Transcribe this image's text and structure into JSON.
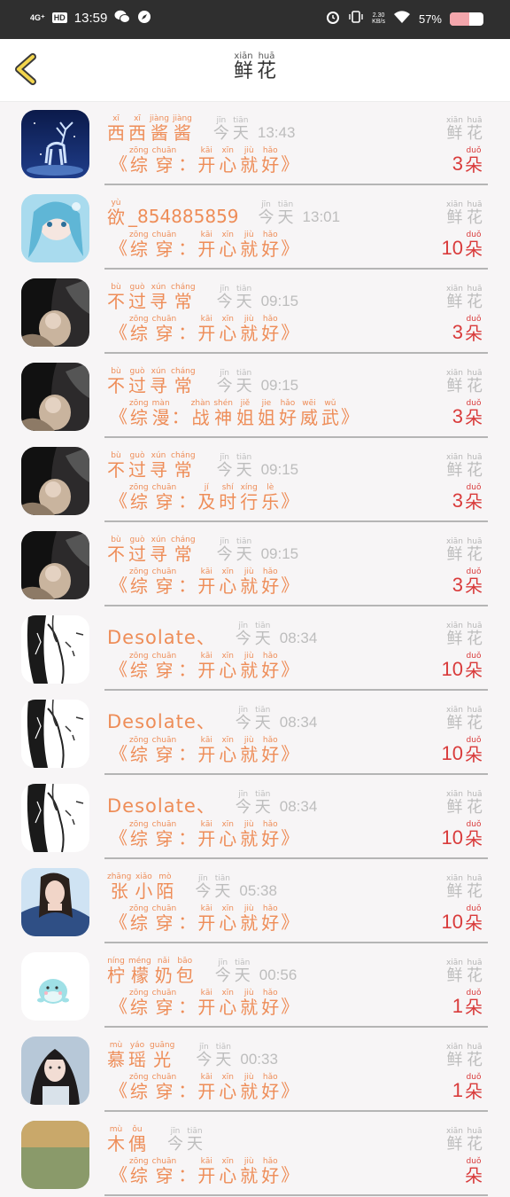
{
  "statusbar": {
    "network": "4G⁺",
    "hd": "HD",
    "time": "13:59",
    "speed_value": "2.30",
    "speed_unit": "KB/s",
    "battery_pct": "57%",
    "battery_level": 0.57
  },
  "header": {
    "title": [
      {
        "py": "xiān",
        "hz": "鲜"
      },
      {
        "py": "huā",
        "hz": "花"
      }
    ]
  },
  "common": {
    "flower_label": [
      {
        "py": "xiān",
        "hz": "鲜"
      },
      {
        "py": "huā",
        "hz": "花"
      }
    ],
    "duo": {
      "py": "duǒ",
      "hz": "朵"
    },
    "today": [
      {
        "py": "jīn",
        "hz": "今"
      },
      {
        "py": "tiān",
        "hz": "天"
      }
    ],
    "open_quote": "《",
    "close_quote": "》"
  },
  "rows": [
    {
      "avatar": "deer",
      "name": [
        {
          "py": "xī",
          "hz": "西"
        },
        {
          "py": "xī",
          "hz": "西"
        },
        {
          "py": "jiàng",
          "hz": "酱"
        },
        {
          "py": "jiàng",
          "hz": "酱"
        }
      ],
      "time": "13:43",
      "msg_type": [
        {
          "py": "zōng",
          "hz": "综"
        },
        {
          "py": "chuān",
          "hz": "穿"
        }
      ],
      "colon": "：",
      "msg_title": [
        {
          "py": "kāi",
          "hz": "开"
        },
        {
          "py": "xīn",
          "hz": "心"
        },
        {
          "py": "jiù",
          "hz": "就"
        },
        {
          "py": "hǎo",
          "hz": "好"
        }
      ],
      "count": "3"
    },
    {
      "avatar": "anime-blue",
      "name": [
        {
          "py": "yù",
          "hz": "欲"
        }
      ],
      "name_suffix": "_854885859",
      "time": "13:01",
      "msg_type": [
        {
          "py": "zōng",
          "hz": "综"
        },
        {
          "py": "chuān",
          "hz": "穿"
        }
      ],
      "colon": "：",
      "msg_title": [
        {
          "py": "kāi",
          "hz": "开"
        },
        {
          "py": "xīn",
          "hz": "心"
        },
        {
          "py": "jiù",
          "hz": "就"
        },
        {
          "py": "hǎo",
          "hz": "好"
        }
      ],
      "count": "10"
    },
    {
      "avatar": "dark-photo",
      "name": [
        {
          "py": "bù",
          "hz": "不"
        },
        {
          "py": "guò",
          "hz": "过"
        },
        {
          "py": "xún",
          "hz": "寻"
        },
        {
          "py": "cháng",
          "hz": "常"
        }
      ],
      "time": "09:15",
      "msg_type": [
        {
          "py": "zōng",
          "hz": "综"
        },
        {
          "py": "chuān",
          "hz": "穿"
        }
      ],
      "colon": "：",
      "msg_title": [
        {
          "py": "kāi",
          "hz": "开"
        },
        {
          "py": "xīn",
          "hz": "心"
        },
        {
          "py": "jiù",
          "hz": "就"
        },
        {
          "py": "hǎo",
          "hz": "好"
        }
      ],
      "count": "3"
    },
    {
      "avatar": "dark-photo",
      "name": [
        {
          "py": "bù",
          "hz": "不"
        },
        {
          "py": "guò",
          "hz": "过"
        },
        {
          "py": "xún",
          "hz": "寻"
        },
        {
          "py": "cháng",
          "hz": "常"
        }
      ],
      "time": "09:15",
      "msg_type": [
        {
          "py": "zōng",
          "hz": "综"
        },
        {
          "py": "màn",
          "hz": "漫"
        }
      ],
      "colon": "：",
      "msg_title": [
        {
          "py": "zhàn",
          "hz": "战"
        },
        {
          "py": "shén",
          "hz": "神"
        },
        {
          "py": "jiě",
          "hz": "姐"
        },
        {
          "py": "jie",
          "hz": "姐"
        },
        {
          "py": "hǎo",
          "hz": "好"
        },
        {
          "py": "wēi",
          "hz": "威"
        },
        {
          "py": "wǔ",
          "hz": "武"
        }
      ],
      "count": "3"
    },
    {
      "avatar": "dark-photo",
      "name": [
        {
          "py": "bù",
          "hz": "不"
        },
        {
          "py": "guò",
          "hz": "过"
        },
        {
          "py": "xún",
          "hz": "寻"
        },
        {
          "py": "cháng",
          "hz": "常"
        }
      ],
      "time": "09:15",
      "msg_type": [
        {
          "py": "zōng",
          "hz": "综"
        },
        {
          "py": "chuān",
          "hz": "穿"
        }
      ],
      "colon": "：",
      "msg_title": [
        {
          "py": "jí",
          "hz": "及"
        },
        {
          "py": "shí",
          "hz": "时"
        },
        {
          "py": "xíng",
          "hz": "行"
        },
        {
          "py": "lè",
          "hz": "乐"
        }
      ],
      "count": "3"
    },
    {
      "avatar": "dark-photo",
      "name": [
        {
          "py": "bù",
          "hz": "不"
        },
        {
          "py": "guò",
          "hz": "过"
        },
        {
          "py": "xún",
          "hz": "寻"
        },
        {
          "py": "cháng",
          "hz": "常"
        }
      ],
      "time": "09:15",
      "msg_type": [
        {
          "py": "zōng",
          "hz": "综"
        },
        {
          "py": "chuān",
          "hz": "穿"
        }
      ],
      "colon": "：",
      "msg_title": [
        {
          "py": "kāi",
          "hz": "开"
        },
        {
          "py": "xīn",
          "hz": "心"
        },
        {
          "py": "jiù",
          "hz": "就"
        },
        {
          "py": "hǎo",
          "hz": "好"
        }
      ],
      "count": "3"
    },
    {
      "avatar": "manga",
      "name_text": "Desolate、",
      "time": "08:34",
      "msg_type": [
        {
          "py": "zōng",
          "hz": "综"
        },
        {
          "py": "chuān",
          "hz": "穿"
        }
      ],
      "colon": "：",
      "msg_title": [
        {
          "py": "kāi",
          "hz": "开"
        },
        {
          "py": "xīn",
          "hz": "心"
        },
        {
          "py": "jiù",
          "hz": "就"
        },
        {
          "py": "hǎo",
          "hz": "好"
        }
      ],
      "count": "10"
    },
    {
      "avatar": "manga",
      "name_text": "Desolate、",
      "time": "08:34",
      "msg_type": [
        {
          "py": "zōng",
          "hz": "综"
        },
        {
          "py": "chuān",
          "hz": "穿"
        }
      ],
      "colon": "：",
      "msg_title": [
        {
          "py": "kāi",
          "hz": "开"
        },
        {
          "py": "xīn",
          "hz": "心"
        },
        {
          "py": "jiù",
          "hz": "就"
        },
        {
          "py": "hǎo",
          "hz": "好"
        }
      ],
      "count": "10"
    },
    {
      "avatar": "manga",
      "name_text": "Desolate、",
      "time": "08:34",
      "msg_type": [
        {
          "py": "zōng",
          "hz": "综"
        },
        {
          "py": "chuān",
          "hz": "穿"
        }
      ],
      "colon": "：",
      "msg_title": [
        {
          "py": "kāi",
          "hz": "开"
        },
        {
          "py": "xīn",
          "hz": "心"
        },
        {
          "py": "jiù",
          "hz": "就"
        },
        {
          "py": "hǎo",
          "hz": "好"
        }
      ],
      "count": "10"
    },
    {
      "avatar": "girl-denim",
      "name": [
        {
          "py": "zhāng",
          "hz": "张"
        },
        {
          "py": "xiǎo",
          "hz": "小"
        },
        {
          "py": "mò",
          "hz": "陌"
        }
      ],
      "time": "05:38",
      "msg_type": [
        {
          "py": "zōng",
          "hz": "综"
        },
        {
          "py": "chuān",
          "hz": "穿"
        }
      ],
      "colon": "：",
      "msg_title": [
        {
          "py": "kāi",
          "hz": "开"
        },
        {
          "py": "xīn",
          "hz": "心"
        },
        {
          "py": "jiù",
          "hz": "就"
        },
        {
          "py": "hǎo",
          "hz": "好"
        }
      ],
      "count": "10"
    },
    {
      "avatar": "cute-turtle",
      "name": [
        {
          "py": "níng",
          "hz": "柠"
        },
        {
          "py": "méng",
          "hz": "檬"
        },
        {
          "py": "nǎi",
          "hz": "奶"
        },
        {
          "py": "bāo",
          "hz": "包"
        }
      ],
      "time": "00:56",
      "msg_type": [
        {
          "py": "zōng",
          "hz": "综"
        },
        {
          "py": "chuān",
          "hz": "穿"
        }
      ],
      "colon": "：",
      "msg_title": [
        {
          "py": "kāi",
          "hz": "开"
        },
        {
          "py": "xīn",
          "hz": "心"
        },
        {
          "py": "jiù",
          "hz": "就"
        },
        {
          "py": "hǎo",
          "hz": "好"
        }
      ],
      "count": "1"
    },
    {
      "avatar": "girl-actress",
      "name": [
        {
          "py": "mù",
          "hz": "慕"
        },
        {
          "py": "yáo",
          "hz": "瑶"
        },
        {
          "py": "guāng",
          "hz": "光"
        }
      ],
      "time": "00:33",
      "msg_type": [
        {
          "py": "zōng",
          "hz": "综"
        },
        {
          "py": "chuān",
          "hz": "穿"
        }
      ],
      "colon": "：",
      "msg_title": [
        {
          "py": "kāi",
          "hz": "开"
        },
        {
          "py": "xīn",
          "hz": "心"
        },
        {
          "py": "jiù",
          "hz": "就"
        },
        {
          "py": "hǎo",
          "hz": "好"
        }
      ],
      "count": "1"
    },
    {
      "avatar": "partial",
      "name": [
        {
          "py": "mù",
          "hz": "木"
        },
        {
          "py": "ǒu",
          "hz": "偶"
        }
      ],
      "time": "",
      "msg_type": [
        {
          "py": "zōng",
          "hz": "综"
        },
        {
          "py": "chuān",
          "hz": "穿"
        }
      ],
      "colon": "：",
      "msg_title": [
        {
          "py": "kāi",
          "hz": "开"
        },
        {
          "py": "xīn",
          "hz": "心"
        },
        {
          "py": "jiù",
          "hz": "就"
        },
        {
          "py": "hǎo",
          "hz": "好"
        }
      ],
      "count": ""
    }
  ]
}
